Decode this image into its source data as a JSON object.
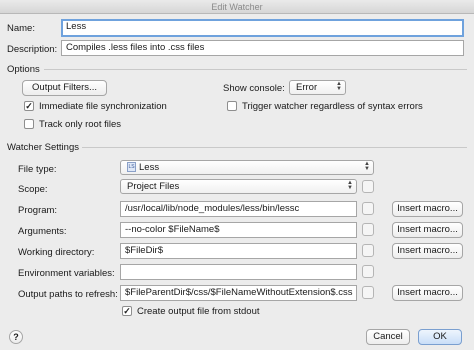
{
  "window": {
    "title": "Edit Watcher"
  },
  "name": {
    "label": "Name:",
    "value": "Less"
  },
  "description": {
    "label": "Description:",
    "value": "Compiles .less files into .css files"
  },
  "options": {
    "section_title": "Options",
    "output_filters_label": "Output Filters...",
    "show_console_label": "Show console:",
    "show_console_value": "Error",
    "immediate_sync_label": "Immediate file synchronization",
    "immediate_sync_checked": true,
    "trigger_regardless_label": "Trigger watcher regardless of syntax errors",
    "trigger_regardless_checked": false,
    "track_root_label": "Track only root files",
    "track_root_checked": false
  },
  "watcher": {
    "section_title": "Watcher Settings",
    "file_type_label": "File type:",
    "file_type_value": "Less",
    "file_type_icon": "less-file-icon",
    "scope_label": "Scope:",
    "scope_value": "Project Files",
    "program_label": "Program:",
    "program_value": "/usr/local/lib/node_modules/less/bin/lessc",
    "arguments_label": "Arguments:",
    "arguments_value": "--no-color $FileName$",
    "working_dir_label": "Working directory:",
    "working_dir_value": "$FileDir$",
    "env_label": "Environment variables:",
    "env_value": "",
    "output_paths_label": "Output paths to refresh:",
    "output_paths_value": "$FileParentDir$/css/$FileNameWithoutExtension$.css",
    "insert_macro_label": "Insert macro...",
    "create_output_label": "Create output file from stdout",
    "create_output_checked": true
  },
  "footer": {
    "cancel_label": "Cancel",
    "ok_label": "OK",
    "help_label": "?"
  }
}
